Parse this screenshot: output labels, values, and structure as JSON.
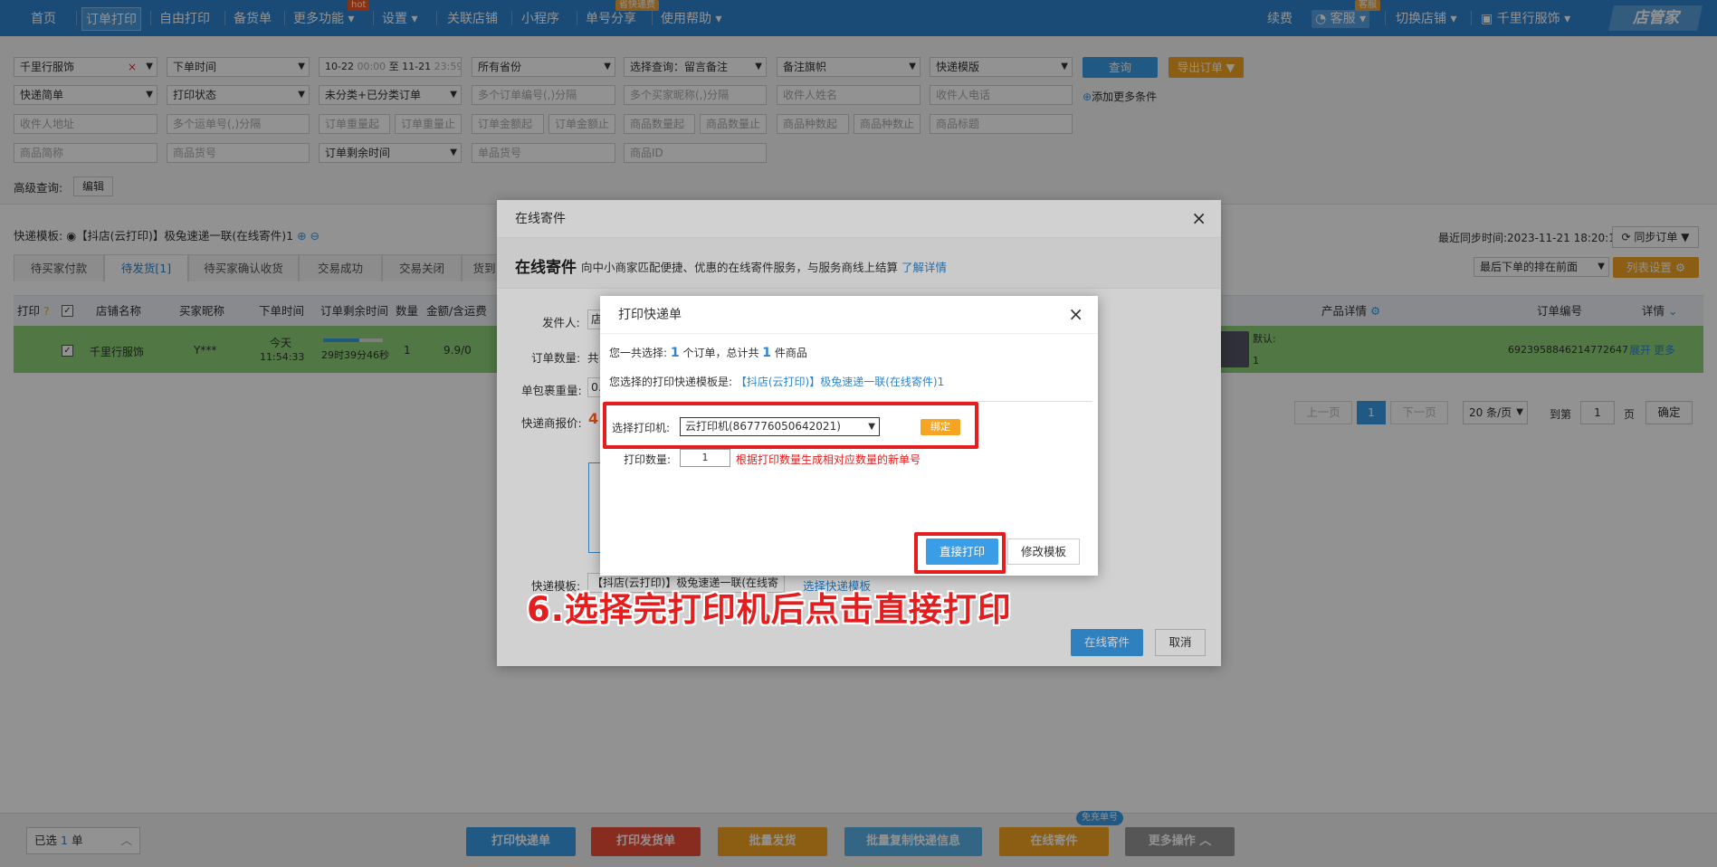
{
  "nav": {
    "items": [
      "首页",
      "订单打印",
      "自由打印",
      "备货单",
      "更多功能",
      "设置",
      "关联店铺",
      "小程序",
      "单号分享",
      "使用帮助"
    ],
    "hot_badge": "hot",
    "share_badge": "省快递费",
    "right": {
      "renew": "续费",
      "service": "客服",
      "service_badge": "客服",
      "switch_shop": "切换店铺",
      "shop_name": "千里行服饰",
      "logo": "店管家"
    }
  },
  "filters": {
    "row1": [
      "千里行服饰",
      "下单时间",
      "所有省份",
      "选择查询：留言备注",
      "备注旗帜",
      "快递模版"
    ],
    "date_start": "10-22",
    "date_start_time": "00:00",
    "date_sep": "至",
    "date_end": "11-21",
    "date_end_time": "23:59",
    "query_button": "查询",
    "export_button": "导出订单",
    "row2": [
      "快递简单",
      "打印状态",
      "未分类+已分类订单"
    ],
    "row2_inputs": [
      "多个订单编号(,)分隔",
      "多个买家昵称(,)分隔",
      "收件人姓名",
      "收件人电话"
    ],
    "add_more": "添加更多条件",
    "row3": [
      "收件人地址",
      "多个运单号(,)分隔",
      "订单重量起",
      "订单重量止",
      "订单金额起",
      "订单金额止",
      "商品数量起",
      "商品数量止",
      "商品种数起",
      "商品种数止",
      "商品标题"
    ],
    "row4": [
      "商品简称",
      "商品货号",
      "订单剩余时间",
      "单品货号",
      "商品ID"
    ],
    "advanced_label": "高级查询:",
    "advanced_button": "编辑"
  },
  "list": {
    "template_label": "快递模板:",
    "template_value": "【抖店(云打印)】极兔速递一联(在线寄件)1",
    "sync_time": "最近同步时间:2023-11-21 18:20:13",
    "sync_button": "同步订单",
    "sort_value": "最后下单的排在前面",
    "columns_button": "列表设置",
    "tabs": [
      "待买家付款",
      "待发货[1]",
      "待买家确认收货",
      "交易成功",
      "交易关闭",
      "货到"
    ],
    "headers": {
      "print": "打印",
      "shop": "店铺名称",
      "buyer": "买家昵称",
      "time": "下单时间",
      "remain": "订单剩余时间",
      "qty": "数量",
      "amount": "金额/含运费",
      "product": "产品详情",
      "order_no": "订单编号",
      "detail": "详情"
    },
    "row": {
      "shop": "千里行服饰",
      "buyer": "Y***",
      "time1": "今天",
      "time2": "11:54:33",
      "remain": "29时39分46秒",
      "qty": "1",
      "amount": "9.9/0",
      "product_label": "默认:",
      "product_qty": "1",
      "order_no": "6923958846214772647",
      "expand": "展开",
      "more": "更多"
    },
    "pager": {
      "prev": "上一页",
      "page": "1",
      "next": "下一页",
      "per_page": "20 条/页",
      "goto": "到第",
      "page_input": "1",
      "page_unit": "页",
      "confirm": "确定"
    }
  },
  "bottom": {
    "selected_prefix": "已选",
    "selected_count": "1",
    "selected_suffix": "单",
    "buttons": [
      "打印快递单",
      "打印发货单",
      "批量发货",
      "批量复制快递信息",
      "在线寄件",
      "更多操作"
    ],
    "free_badge": "免充单号"
  },
  "outer_dialog": {
    "title": "在线寄件",
    "heading": "在线寄件",
    "desc": "向中小商家匹配便捷、优惠的在线寄件服务，与服务商线上结算",
    "learn_more": "了解详情",
    "labels": [
      "发件人:",
      "订单数量:",
      "单包裹重量:",
      "快递商报价:"
    ],
    "sender_value": "店",
    "order_qty_value": "共",
    "weight_value": "0.",
    "price_value": "4",
    "template_label": "快递模板:",
    "template_value": "【抖店(云打印)】极兔速递一联(在线寄",
    "template_link": "选择快递模板",
    "submit": "在线寄件",
    "cancel": "取消"
  },
  "print_dialog": {
    "title": "打印快递单",
    "summary_prefix": "您一共选择:",
    "order_count": "1",
    "summary_mid": "个订单，总计共",
    "item_count": "1",
    "summary_suffix": "件商品",
    "template_prefix": "您选择的打印快递模板是:",
    "template_name": "【抖店(云打印)】极兔速递一联(在线寄件)1",
    "printer_label": "选择打印机:",
    "printer_value": "云打印机(867776050642021)",
    "bind_button": "绑定",
    "qty_label": "打印数量:",
    "qty_value": "1",
    "qty_note": "根据打印数量生成相对应数量的新单号",
    "print_button": "直接打印",
    "edit_button": "修改模板"
  },
  "annotation": "6.选择完打印机后点击直接打印",
  "colors": {
    "nav": "#2e85d0",
    "accent": "#3a9de8",
    "orange": "#f5a523",
    "red": "#e41e1e",
    "green_row": "#8fd27a"
  }
}
